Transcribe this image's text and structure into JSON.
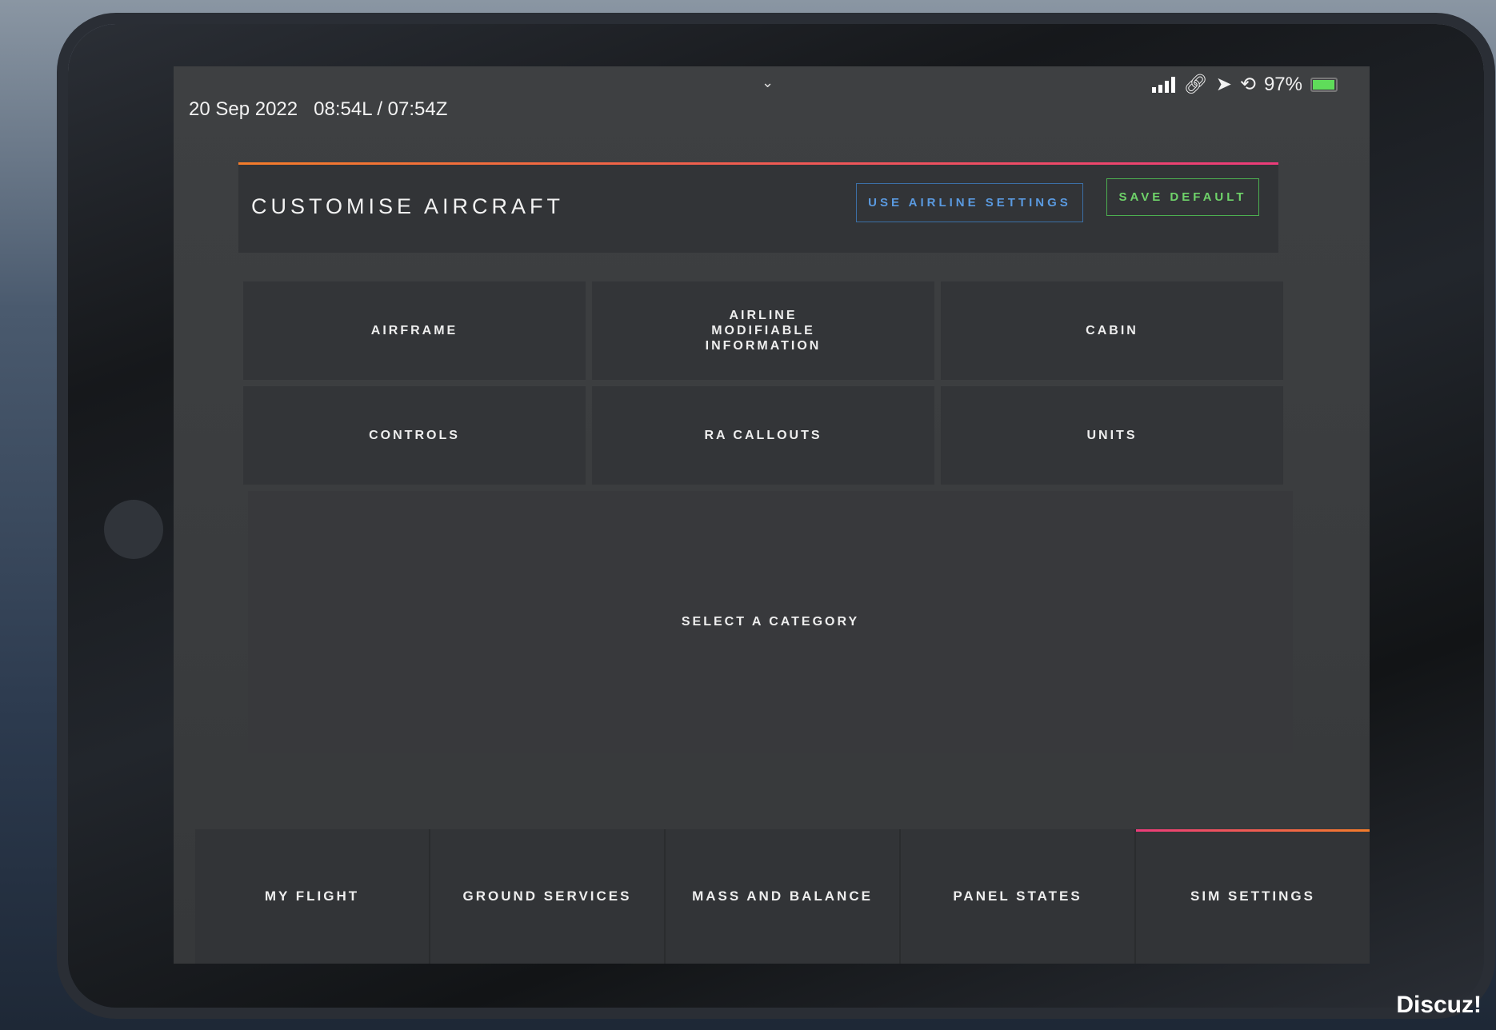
{
  "status_bar": {
    "date": "20 Sep 2022",
    "time": "08:54L / 07:54Z",
    "battery": "97%",
    "battery_level": 0.97,
    "icons": [
      "signal-icon",
      "link-icon",
      "location-icon",
      "rotation-lock-icon",
      "battery-icon"
    ]
  },
  "header": {
    "title": "CUSTOMISE AIRCRAFT",
    "use_airline": "USE AIRLINE SETTINGS",
    "save_default": "SAVE DEFAULT"
  },
  "categories": [
    "AIRFRAME",
    "AIRLINE MODIFIABLE INFORMATION",
    "CABIN",
    "CONTROLS",
    "RA CALLOUTS",
    "UNITS"
  ],
  "content": {
    "placeholder": "SELECT A CATEGORY"
  },
  "nav": {
    "tabs": [
      "MY FLIGHT",
      "GROUND SERVICES",
      "MASS AND BALANCE",
      "PANEL STATES",
      "SIM SETTINGS"
    ],
    "active": "SIM SETTINGS"
  },
  "colors": {
    "accent_orange": "#f47c2a",
    "accent_pink": "#ec3b7a",
    "blue_button": "#5a9ae0",
    "green_button": "#6fd36a"
  },
  "watermark": "Discuz!"
}
